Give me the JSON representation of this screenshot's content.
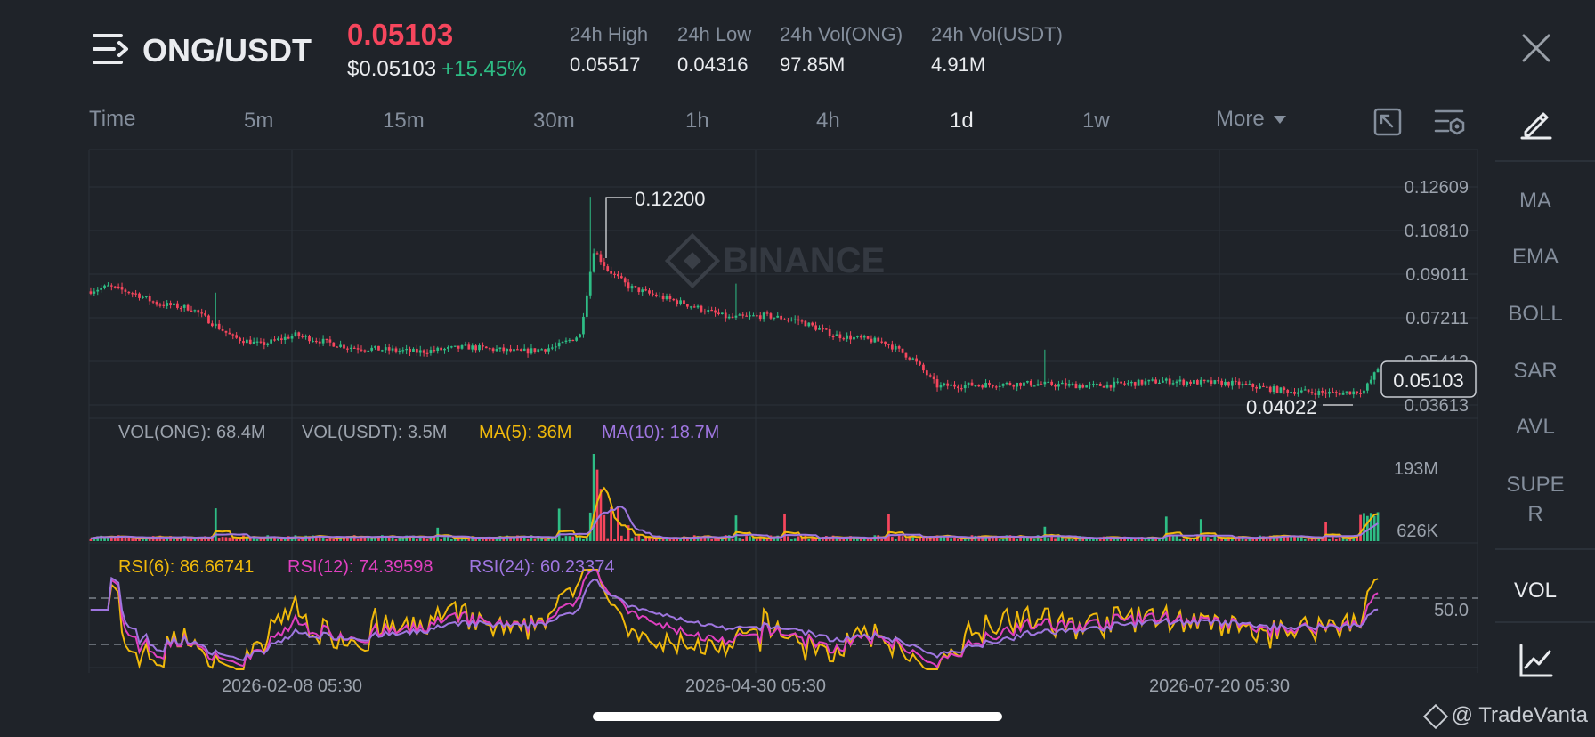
{
  "header": {
    "pair": "ONG/USDT",
    "last_price": "0.05103",
    "usd_price": "$0.05103",
    "change_pct": "+15.45%",
    "stats": [
      {
        "label": "24h High",
        "value": "0.05517"
      },
      {
        "label": "24h Low",
        "value": "0.04316"
      },
      {
        "label": "24h Vol(ONG)",
        "value": "97.85M"
      },
      {
        "label": "24h Vol(USDT)",
        "value": "4.91M"
      }
    ]
  },
  "timeframes": {
    "label": "Time",
    "items": [
      "5m",
      "15m",
      "30m",
      "1h",
      "4h",
      "1d",
      "1w"
    ],
    "active": "1d",
    "more": "More"
  },
  "sidebar": {
    "items": [
      "MA",
      "EMA",
      "BOLL",
      "SAR",
      "AVL",
      "SUPE\nR"
    ],
    "vol": "VOL"
  },
  "colors": {
    "up": "#2ebd85",
    "down": "#f6465d",
    "ma5": "#f0b90b",
    "ma10": "#9f76e0",
    "rsi12": "#e040c0",
    "bg": "#1f2329"
  },
  "chart_data": {
    "type": "candlestick",
    "price_axis_ticks": [
      "0.12609",
      "0.10810",
      "0.09011",
      "0.07211",
      "0.05412",
      "0.03613"
    ],
    "current_price_label": "0.05103",
    "max_label": "0.12200",
    "min_label": "0.04022",
    "watermark": "BINANCE",
    "x_ticks": [
      "2026-02-08 05:30",
      "2026-04-30 05:30",
      "2026-07-20 05:30"
    ],
    "price_anchors": [
      [
        0,
        0.083
      ],
      [
        6,
        0.085
      ],
      [
        14,
        0.082
      ],
      [
        20,
        0.078
      ],
      [
        30,
        0.076
      ],
      [
        36,
        0.07
      ],
      [
        42,
        0.064
      ],
      [
        50,
        0.061
      ],
      [
        60,
        0.065
      ],
      [
        75,
        0.06
      ],
      [
        95,
        0.058
      ],
      [
        110,
        0.06
      ],
      [
        125,
        0.058
      ],
      [
        135,
        0.06
      ],
      [
        142,
        0.065
      ],
      [
        146,
        0.1
      ],
      [
        150,
        0.092
      ],
      [
        156,
        0.085
      ],
      [
        162,
        0.082
      ],
      [
        172,
        0.078
      ],
      [
        185,
        0.072
      ],
      [
        195,
        0.073
      ],
      [
        205,
        0.071
      ],
      [
        215,
        0.065
      ],
      [
        230,
        0.062
      ],
      [
        238,
        0.055
      ],
      [
        245,
        0.044
      ],
      [
        270,
        0.045
      ],
      [
        290,
        0.044
      ],
      [
        310,
        0.046
      ],
      [
        330,
        0.045
      ],
      [
        345,
        0.042
      ],
      [
        360,
        0.041
      ],
      [
        368,
        0.042
      ],
      [
        372,
        0.051
      ]
    ],
    "volume_panel": {
      "labels": {
        "vol_ong": "VOL(ONG): 68.4M",
        "vol_usdt": "VOL(USDT): 3.5M",
        "ma5": "MA(5): 36M",
        "ma10": "MA(10): 18.7M"
      },
      "axis_ticks": [
        "193M",
        "626K"
      ]
    },
    "rsi_panel": {
      "labels": {
        "rsi6": "RSI(6): 86.66741",
        "rsi12": "RSI(12): 74.39598",
        "rsi24": "RSI(24): 60.23374"
      },
      "axis_ticks": [
        "50.0"
      ],
      "last": {
        "rsi6": 86.66741,
        "rsi12": 74.39598,
        "rsi24": 60.23374
      }
    }
  },
  "watermark_text": "@ TradeVanta"
}
